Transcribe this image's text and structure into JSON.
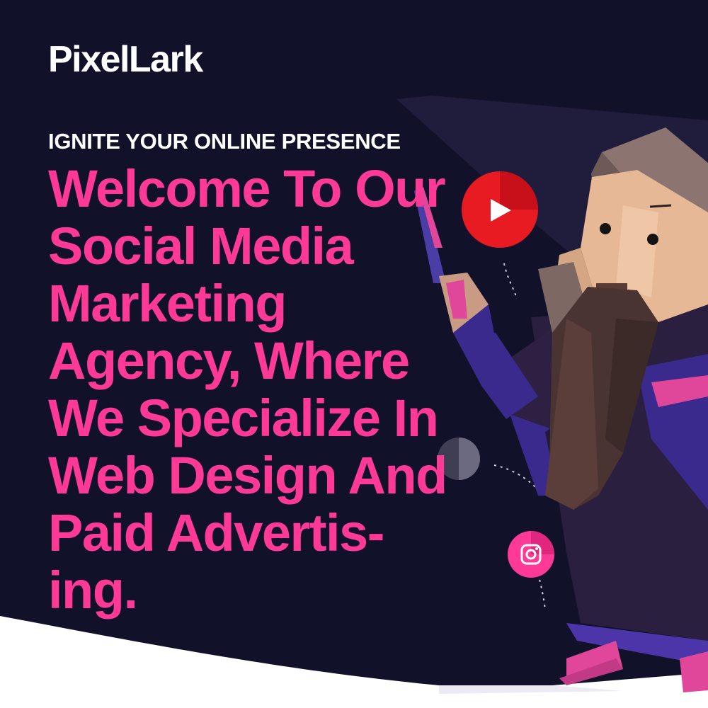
{
  "brand": {
    "name": "PixelLark"
  },
  "hero": {
    "tagline": "IGNITE YOUR ONLINE PRESENCE",
    "headline_lines": [
      "Welcome To Our",
      "Social Media",
      "Marketing",
      "Agency, Where",
      "We Specialize In",
      "Web Design And",
      "Paid Advertis-",
      "ing."
    ]
  },
  "illustration": {
    "subject": "wizard-character",
    "icons": [
      "youtube-play-icon",
      "instagram-icon",
      "grey-orb-icon"
    ]
  },
  "colors": {
    "background": "#12112a",
    "accent_pink": "#ff3a96",
    "text_white": "#ffffff",
    "robe_purple": "#3a2a8e",
    "youtube_red": "#e81a22"
  }
}
